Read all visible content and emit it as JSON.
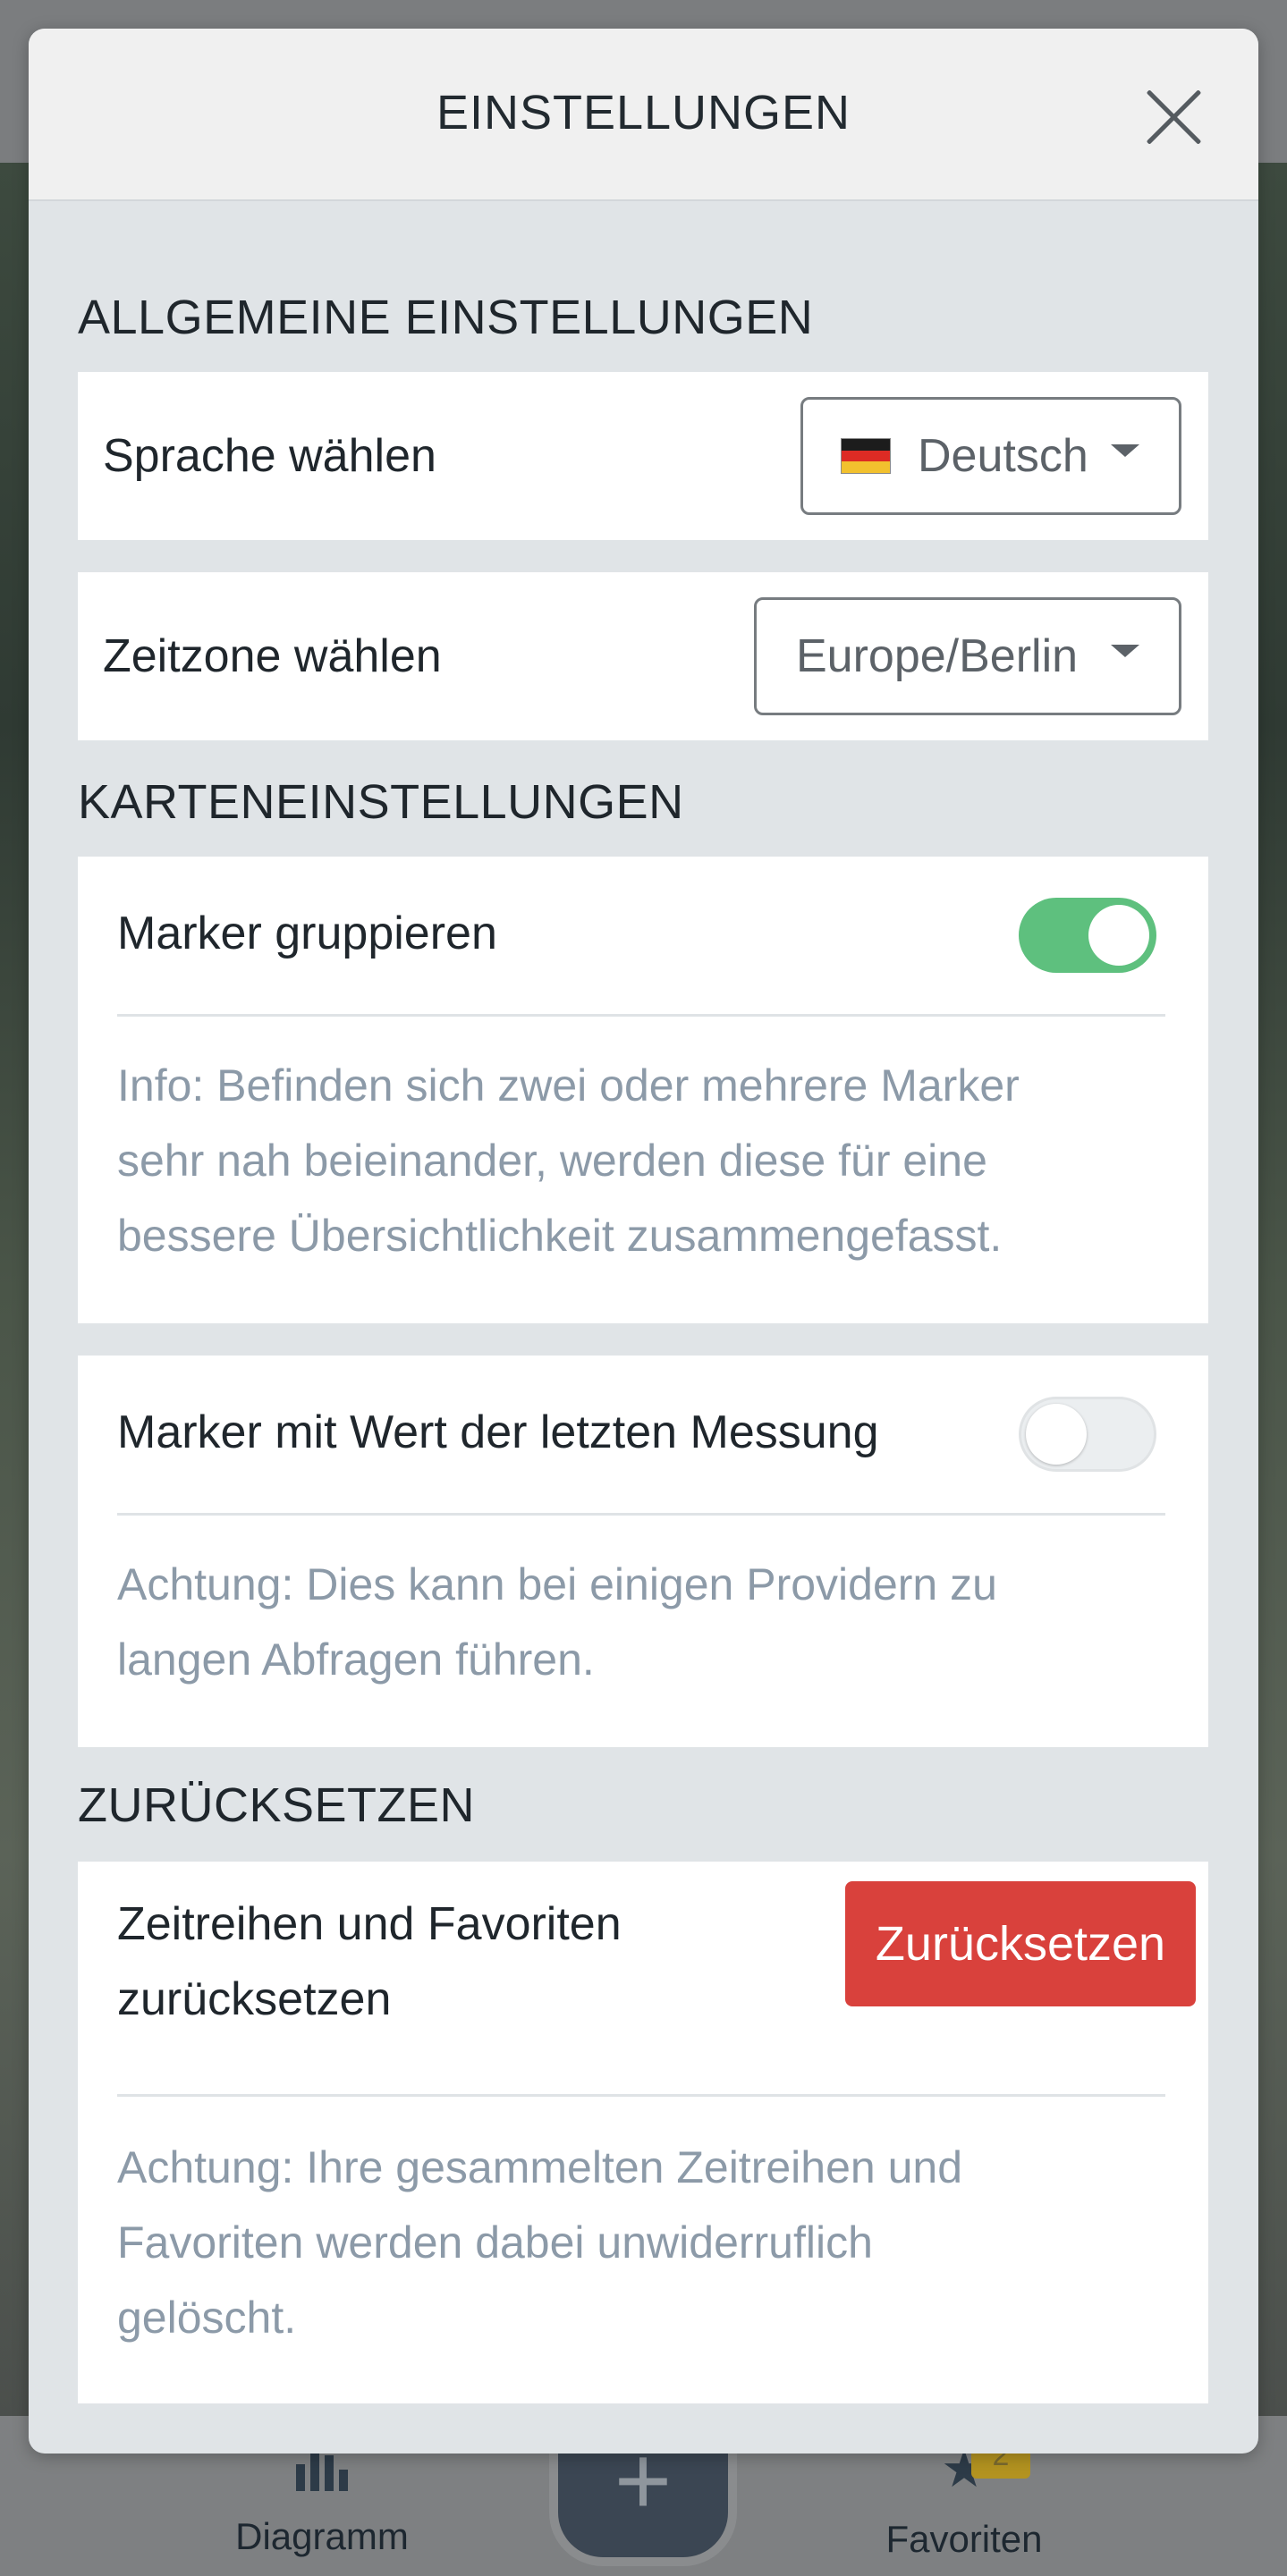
{
  "modal": {
    "title": "EINSTELLUNGEN"
  },
  "general": {
    "heading": "ALLGEMEINE EINSTELLUNGEN",
    "language": {
      "label": "Sprache wählen",
      "value": "Deutsch",
      "flag_icon": "flag-de-icon"
    },
    "timezone": {
      "label": "Zeitzone wählen",
      "value": "Europe/Berlin"
    }
  },
  "map": {
    "heading": "KARTENEINSTELLUNGEN",
    "group_markers": {
      "label": "Marker gruppieren",
      "enabled": true,
      "info_lines": [
        "Info: Befinden sich zwei oder mehrere Marker",
        "sehr nah beieinander, werden diese für eine",
        "bessere Übersichtlichkeit zusammengefasst."
      ]
    },
    "last_value_markers": {
      "label": "Marker mit Wert der letzten Messung",
      "enabled": false,
      "info_lines": [
        "Achtung: Dies kann bei einigen Providern zu",
        "langen Abfragen führen."
      ]
    }
  },
  "reset": {
    "heading": "ZURÜCKSETZEN",
    "label_lines": [
      "Zeitreihen und Favoriten",
      "zurücksetzen"
    ],
    "button_label": "Zurücksetzen",
    "info_lines": [
      "Achtung: Ihre gesammelten Zeitreihen und",
      "Favoriten werden dabei unwiderruflich",
      "gelöscht."
    ]
  },
  "bottom_nav": {
    "diagram_label": "Diagramm",
    "favorites_label": "Favoriten",
    "favorites_count": "2",
    "add_icon": "plus-icon"
  },
  "colors": {
    "toggle_on": "#5ec07e",
    "reset_button": "#d9413c",
    "info_text": "#8c9aa8"
  }
}
